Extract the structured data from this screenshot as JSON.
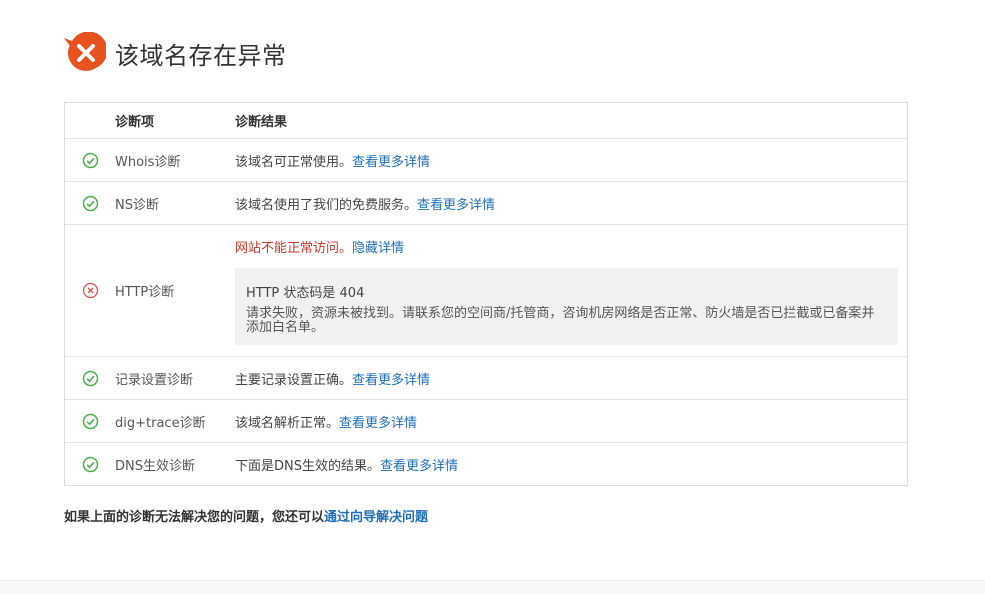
{
  "header": {
    "title": "该域名存在异常",
    "icon": "error-x-icon",
    "icon_color": "#e8521f"
  },
  "table": {
    "col_item": "诊断项",
    "col_result": "诊断结果",
    "rows": [
      {
        "status": "ok",
        "name": "Whois诊断",
        "result": "该域名可正常使用。",
        "link": "查看更多详情"
      },
      {
        "status": "ok",
        "name": "NS诊断",
        "result": "该域名使用了我们的免费服务。",
        "link": "查看更多详情"
      },
      {
        "status": "error",
        "name": "HTTP诊断",
        "result": "网站不能正常访问。",
        "link": "隐藏详情",
        "detail_code": "HTTP 状态码是 404",
        "detail_desc": "请求失败，资源未被找到。请联系您的空间商/托管商，咨询机房网络是否正常、防火墙是否已拦截或已备案并添加白名单。"
      },
      {
        "status": "ok",
        "name": "记录设置诊断",
        "result": "主要记录设置正确。",
        "link": "查看更多详情"
      },
      {
        "status": "ok",
        "name": "dig+trace诊断",
        "result": "该域名解析正常。",
        "link": "查看更多详情"
      },
      {
        "status": "ok",
        "name": "DNS生效诊断",
        "result": "下面是DNS生效的结果。",
        "link": "查看更多详情"
      }
    ]
  },
  "footer": {
    "text": "如果上面的诊断无法解决您的问题，您还可以",
    "link": "通过向导解决问题"
  },
  "colors": {
    "ok": "#4caf50",
    "error": "#d9534f",
    "link": "#1e6fb8"
  }
}
